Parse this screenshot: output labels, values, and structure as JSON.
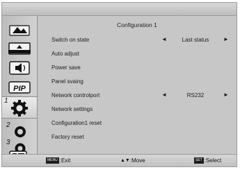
{
  "content": {
    "title": "Configuration 1",
    "rows": [
      {
        "label": "Switch on state",
        "value": "Last status"
      },
      {
        "label": "Auto adjust"
      },
      {
        "label": "Power save"
      },
      {
        "label": "Panel svaing"
      },
      {
        "label": "Network controlport",
        "value": "RS232"
      },
      {
        "label": "Network settings"
      },
      {
        "label": "Configuration1 reset"
      },
      {
        "label": "Factory reset"
      }
    ]
  },
  "sidebar": {
    "items": [
      {
        "icon": "picture-icon"
      },
      {
        "icon": "screen-icon"
      },
      {
        "icon": "audio-icon"
      },
      {
        "icon": "pip-icon",
        "label": "PIP"
      },
      {
        "icon": "config-gear-icon",
        "index": "1"
      },
      {
        "icon": "config-gear-icon",
        "index": "2"
      },
      {
        "icon": "config-gear-icon",
        "index": "3"
      },
      {
        "icon": "input-icon"
      }
    ]
  },
  "footer": {
    "exit": {
      "key": "MENU",
      "label": ":Exit"
    },
    "move": {
      "key": "▲▼",
      "label": ":Move"
    },
    "select": {
      "key": "SET",
      "label": ":Select"
    }
  }
}
